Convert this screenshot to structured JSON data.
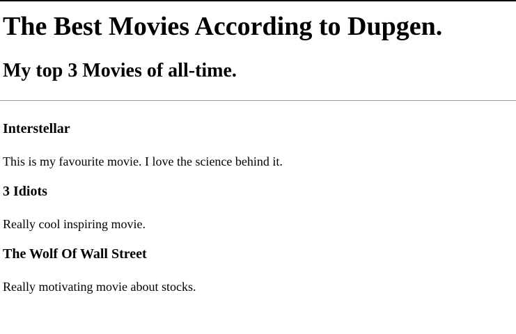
{
  "header": {
    "title": "The Best Movies According to Dupgen.",
    "subtitle": "My top 3 Movies of all-time."
  },
  "movies": [
    {
      "name": "Interstellar",
      "description": "This is my favourite movie. I love the science behind it."
    },
    {
      "name": "3 Idiots",
      "description": "Really cool inspiring movie."
    },
    {
      "name": "The Wolf Of Wall Street",
      "description": "Really motivating movie about stocks."
    }
  ]
}
